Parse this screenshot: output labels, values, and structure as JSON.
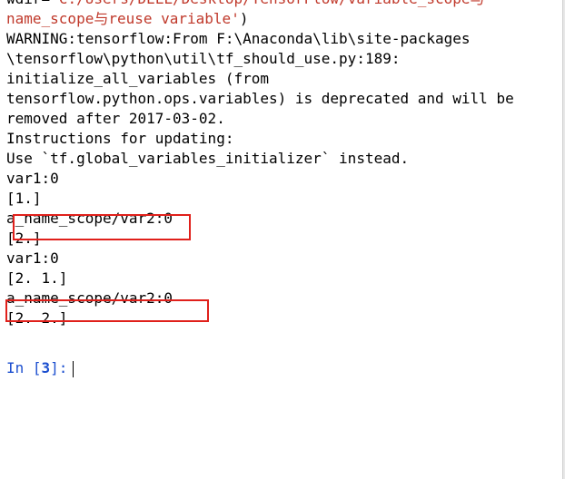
{
  "console": {
    "run_line": {
      "prefix": "wdir=",
      "string_part1": "'C:/Users/DELL/Desktop/TensorFlow/variable_scope与",
      "string_part2": "name_scope与reuse variable'",
      "suffix": ")"
    },
    "warning_lines": [
      "WARNING:tensorflow:From F:\\Anaconda\\lib\\site-packages",
      "\\tensorflow\\python\\util\\tf_should_use.py:189:",
      "initialize_all_variables (from",
      "tensorflow.python.ops.variables) is deprecated and will be",
      "removed after 2017-03-02.",
      "Instructions for updating:",
      "Use `tf.global_variables_initializer` instead."
    ],
    "output_lines": [
      "var1:0",
      "[1.]",
      "a_name_scope/var2:0",
      "[2.]",
      "var1:0",
      "[2. 1.]",
      "a_name_scope/var2:0",
      "[2. 2.]"
    ],
    "prompt": {
      "in_label": "In [",
      "number": "3",
      "close": "]:"
    }
  },
  "colors": {
    "string": "#c0392b",
    "prompt": "#1c4fcf",
    "highlight_box": "#e0201b"
  }
}
